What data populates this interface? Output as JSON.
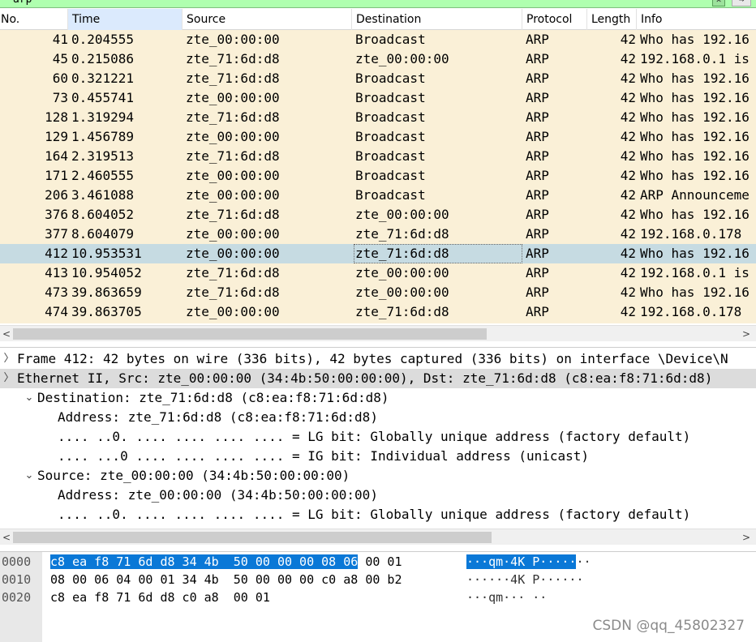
{
  "filter": {
    "text": "arp",
    "clear_label": "✕",
    "dropdown_label": "→"
  },
  "columns": {
    "no": "No.",
    "time": "Time",
    "source": "Source",
    "destination": "Destination",
    "protocol": "Protocol",
    "length": "Length",
    "info": "Info"
  },
  "packets": [
    {
      "no": "41",
      "time": "0.204555",
      "src": "zte_00:00:00",
      "dst": "Broadcast",
      "proto": "ARP",
      "len": "42",
      "info": "Who has 192.16"
    },
    {
      "no": "45",
      "time": "0.215086",
      "src": "zte_71:6d:d8",
      "dst": "zte_00:00:00",
      "proto": "ARP",
      "len": "42",
      "info": "192.168.0.1 is"
    },
    {
      "no": "60",
      "time": "0.321221",
      "src": "zte_71:6d:d8",
      "dst": "Broadcast",
      "proto": "ARP",
      "len": "42",
      "info": "Who has 192.16"
    },
    {
      "no": "73",
      "time": "0.455741",
      "src": "zte_00:00:00",
      "dst": "Broadcast",
      "proto": "ARP",
      "len": "42",
      "info": "Who has 192.16"
    },
    {
      "no": "128",
      "time": "1.319294",
      "src": "zte_71:6d:d8",
      "dst": "Broadcast",
      "proto": "ARP",
      "len": "42",
      "info": "Who has 192.16"
    },
    {
      "no": "129",
      "time": "1.456789",
      "src": "zte_00:00:00",
      "dst": "Broadcast",
      "proto": "ARP",
      "len": "42",
      "info": "Who has 192.16"
    },
    {
      "no": "164",
      "time": "2.319513",
      "src": "zte_71:6d:d8",
      "dst": "Broadcast",
      "proto": "ARP",
      "len": "42",
      "info": "Who has 192.16"
    },
    {
      "no": "171",
      "time": "2.460555",
      "src": "zte_00:00:00",
      "dst": "Broadcast",
      "proto": "ARP",
      "len": "42",
      "info": "Who has 192.16"
    },
    {
      "no": "206",
      "time": "3.461088",
      "src": "zte_00:00:00",
      "dst": "Broadcast",
      "proto": "ARP",
      "len": "42",
      "info": "ARP Announceme"
    },
    {
      "no": "376",
      "time": "8.604052",
      "src": "zte_71:6d:d8",
      "dst": "zte_00:00:00",
      "proto": "ARP",
      "len": "42",
      "info": "Who has 192.16"
    },
    {
      "no": "377",
      "time": "8.604079",
      "src": "zte_00:00:00",
      "dst": "zte_71:6d:d8",
      "proto": "ARP",
      "len": "42",
      "info": "192.168.0.178"
    },
    {
      "no": "412",
      "time": "10.953531",
      "src": "zte_00:00:00",
      "dst": "zte_71:6d:d8",
      "proto": "ARP",
      "len": "42",
      "info": "Who has 192.16",
      "selected": true
    },
    {
      "no": "413",
      "time": "10.954052",
      "src": "zte_71:6d:d8",
      "dst": "zte_00:00:00",
      "proto": "ARP",
      "len": "42",
      "info": "192.168.0.1 is"
    },
    {
      "no": "473",
      "time": "39.863659",
      "src": "zte_71:6d:d8",
      "dst": "zte_00:00:00",
      "proto": "ARP",
      "len": "42",
      "info": "Who has 192.16"
    },
    {
      "no": "474",
      "time": "39.863705",
      "src": "zte_00:00:00",
      "dst": "zte_71:6d:d8",
      "proto": "ARP",
      "len": "42",
      "info": "192.168.0.178"
    }
  ],
  "details": [
    {
      "toggle": "〉",
      "indent": 0,
      "text": "Frame 412: 42 bytes on wire (336 bits), 42 bytes captured (336 bits) on interface \\Device\\N",
      "hl": false
    },
    {
      "toggle": "〉",
      "indent": 0,
      "text": "Ethernet II, Src: zte_00:00:00 (34:4b:50:00:00:00), Dst: zte_71:6d:d8 (c8:ea:f8:71:6d:d8)",
      "hl": true
    },
    {
      "toggle": "⌄",
      "indent": 1,
      "text": "Destination: zte_71:6d:d8 (c8:ea:f8:71:6d:d8)",
      "hl": false
    },
    {
      "toggle": "",
      "indent": 2,
      "text": "Address: zte_71:6d:d8 (c8:ea:f8:71:6d:d8)",
      "hl": false
    },
    {
      "toggle": "",
      "indent": 2,
      "text": ".... ..0. .... .... .... .... = LG bit: Globally unique address (factory default)",
      "hl": false
    },
    {
      "toggle": "",
      "indent": 2,
      "text": ".... ...0 .... .... .... .... = IG bit: Individual address (unicast)",
      "hl": false
    },
    {
      "toggle": "⌄",
      "indent": 1,
      "text": "Source: zte_00:00:00 (34:4b:50:00:00:00)",
      "hl": false
    },
    {
      "toggle": "",
      "indent": 2,
      "text": "Address: zte_00:00:00 (34:4b:50:00:00:00)",
      "hl": false
    },
    {
      "toggle": "",
      "indent": 2,
      "text": ".... ..0. .... .... .... .... = LG bit: Globally unique address (factory default)",
      "hl": false
    }
  ],
  "bytes": [
    {
      "offset": "0000",
      "hex_sel": "c8 ea f8 71 6d d8 34 4b  50 00 00 00 08 06",
      "hex_rest": " 00 01",
      "ascii_sel": "···qm·4K P·····",
      "ascii_rest": "··"
    },
    {
      "offset": "0010",
      "hex_sel": "",
      "hex_rest": "08 00 06 04 00 01 34 4b  50 00 00 00 c0 a8 00 b2",
      "ascii_sel": "",
      "ascii_rest": "······4K P······"
    },
    {
      "offset": "0020",
      "hex_sel": "",
      "hex_rest": "c8 ea f8 71 6d d8 c0 a8  00 01",
      "ascii_sel": "",
      "ascii_rest": "···qm··· ··"
    }
  ],
  "scroll": {
    "left": "<",
    "right": ">"
  },
  "watermark": "CSDN @qq_45802327",
  "colors": {
    "arp_row": "#faf0d7",
    "selected_row": "#c6dbe2",
    "byte_highlight": "#0a78d7",
    "filter_ok": "#afffaf"
  }
}
